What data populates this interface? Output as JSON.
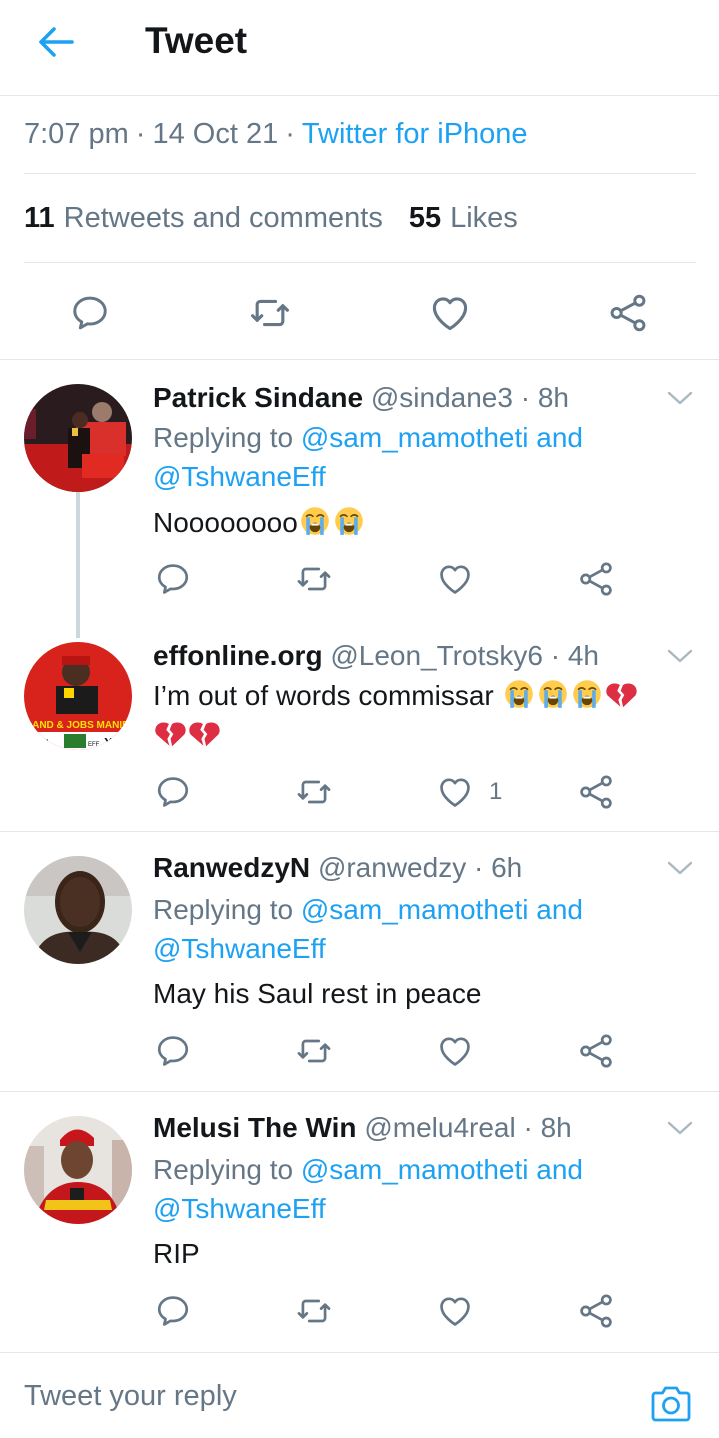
{
  "header": {
    "title": "Tweet"
  },
  "tweet_meta": {
    "time": "7:07 pm",
    "sep1": "·",
    "date": "14 Oct 21",
    "sep2": "·",
    "source": "Twitter for iPhone"
  },
  "stats": {
    "retweets_count": "11",
    "retweets_label": "Retweets and comments",
    "likes_count": "55",
    "likes_label": "Likes"
  },
  "colors": {
    "accent": "#1da1f2",
    "muted": "#657786",
    "text": "#14171a",
    "divider": "#e1e8ed"
  },
  "replies": [
    {
      "name": "Patrick Sindane",
      "handle": "@sindane3",
      "dot": "·",
      "time": "8h",
      "replying_prefix": "Replying to ",
      "replying_to_1": "@sam_mamotheti",
      "replying_and": " and",
      "replying_to_2": "@TshwaneEff",
      "text": "Noooooooo",
      "emoji": [
        "loudly-crying-face",
        "loudly-crying-face"
      ]
    },
    {
      "name": "effonline.org",
      "handle": "@Leon_Trotsky6",
      "dot": "·",
      "time": "4h",
      "text": "I’m out of words commissar ",
      "emoji": [
        "loudly-crying-face",
        "loudly-crying-face",
        "loudly-crying-face",
        "broken-heart",
        "broken-heart",
        "broken-heart"
      ],
      "like_count": "1",
      "avatar_text": {
        "line1": "LAND & JOBS MANIF",
        "line2": "OTE",
        "line3": "EFF",
        "line4": "X"
      }
    },
    {
      "name": "RanwedzyN",
      "handle": "@ranwedzy",
      "dot": "·",
      "time": "6h",
      "replying_prefix": "Replying to ",
      "replying_to_1": "@sam_mamotheti",
      "replying_and": " and",
      "replying_to_2": "@TshwaneEff",
      "text": "May his Saul rest in peace"
    },
    {
      "name": "Melusi The Win",
      "handle": "@melu4real",
      "dot": "·",
      "time": "8h",
      "replying_prefix": "Replying to ",
      "replying_to_1": "@sam_mamotheti",
      "replying_and": " and",
      "replying_to_2": "@TshwaneEff",
      "text": "RIP"
    }
  ],
  "composer": {
    "placeholder": "Tweet your reply"
  },
  "icons": [
    "back-arrow-icon",
    "reply-icon",
    "retweet-icon",
    "like-icon",
    "share-icon",
    "chevron-down-icon",
    "camera-icon"
  ]
}
